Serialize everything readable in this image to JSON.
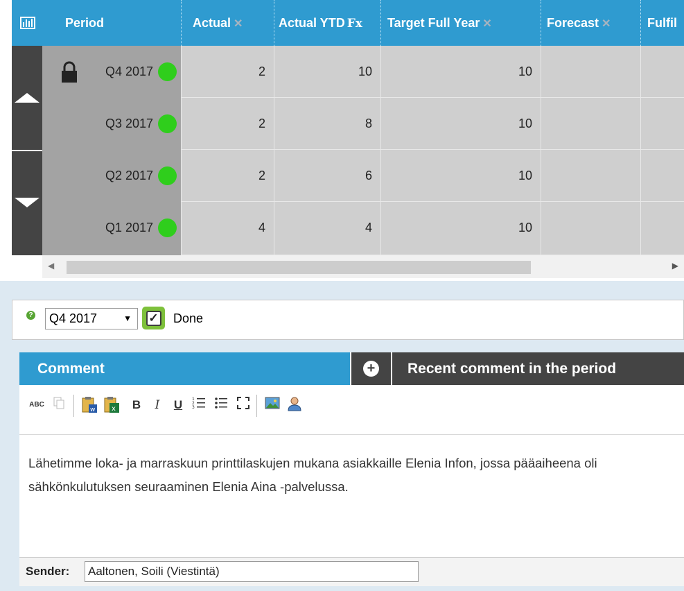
{
  "grid": {
    "columns": [
      {
        "label": "Period"
      },
      {
        "label": "Actual",
        "icon": "pin-disabled-icon"
      },
      {
        "label": "Actual YTD",
        "icon": "formula-icon",
        "icon_text": "Fx"
      },
      {
        "label": "Target Full Year",
        "icon": "pin-disabled-icon"
      },
      {
        "label": "Forecast",
        "icon": "pin-disabled-icon"
      },
      {
        "label": "Fulfil"
      }
    ],
    "rows": [
      {
        "period": "Q4 2017",
        "locked": true,
        "status_color": "#2fce1c",
        "actual": "2",
        "actual_ytd": "10",
        "target": "10",
        "forecast": ""
      },
      {
        "period": "Q3 2017",
        "locked": false,
        "status_color": "#2fce1c",
        "actual": "2",
        "actual_ytd": "8",
        "target": "10",
        "forecast": ""
      },
      {
        "period": "Q2 2017",
        "locked": false,
        "status_color": "#2fce1c",
        "actual": "2",
        "actual_ytd": "6",
        "target": "10",
        "forecast": ""
      },
      {
        "period": "Q1 2017",
        "locked": false,
        "status_color": "#2fce1c",
        "actual": "4",
        "actual_ytd": "4",
        "target": "10",
        "forecast": ""
      }
    ],
    "header_color": "#2f9bd0"
  },
  "period_bar": {
    "help_icon": "help-icon",
    "selected_period": "Q4 2017",
    "done_checked": true,
    "done_label": "Done"
  },
  "tabs": {
    "comment": "Comment",
    "recent": "Recent comment in the period"
  },
  "editor": {
    "toolbar": [
      "spellcheck-icon",
      "copy-icon",
      "paste-word-icon",
      "paste-excel-icon",
      "bold-icon",
      "italic-icon",
      "underline-icon",
      "numbered-list-icon",
      "bulleted-list-icon",
      "fullscreen-icon",
      "image-icon",
      "user-icon"
    ],
    "bold": "B",
    "italic": "I",
    "underline": "U",
    "spellcheck": "ABC",
    "text": "Lähetimme loka- ja marraskuun printtilaskujen mukana asiakkaille Elenia Infon, jossa pääaiheena oli sähkönkulutuksen seuraaminen Elenia Aina -palvelussa."
  },
  "sender": {
    "label": "Sender:",
    "value": "Aaltonen, Soili (Viestintä)"
  }
}
